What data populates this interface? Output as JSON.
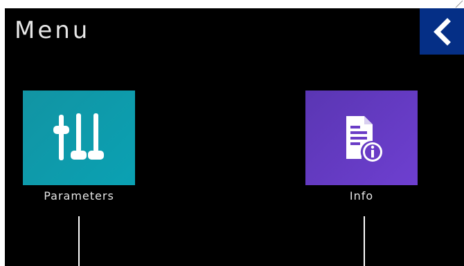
{
  "header": {
    "title": "Menu",
    "back_icon": "chevron-left-icon",
    "back_color": "#052f86"
  },
  "tiles": [
    {
      "label": "Parameters",
      "icon": "sliders-icon",
      "color": "#0aa1b3"
    },
    {
      "label": "Info",
      "icon": "document-info-icon",
      "color": "#6e3fd0"
    }
  ]
}
